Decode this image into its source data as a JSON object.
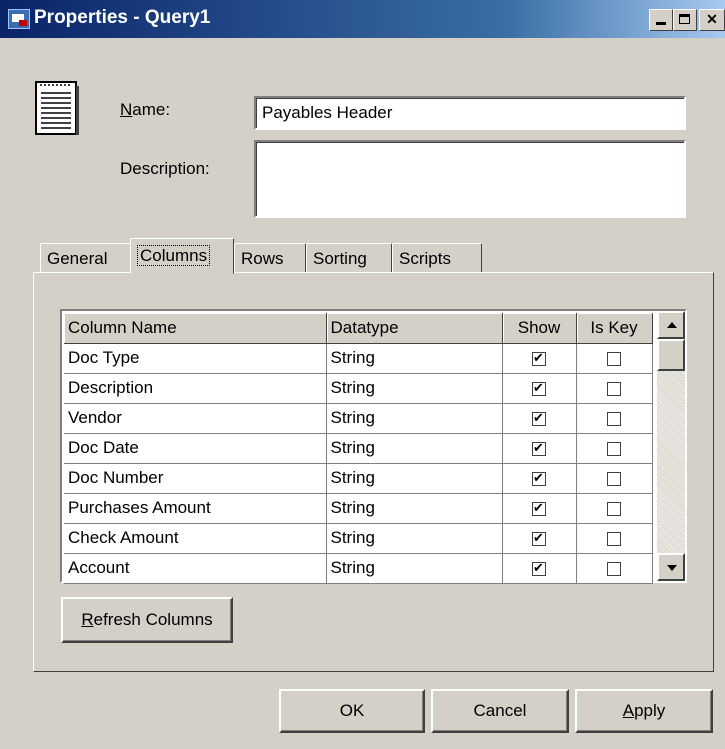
{
  "window": {
    "title": "Properties - Query1",
    "controls": [
      "minimize",
      "maximize",
      "close"
    ]
  },
  "form": {
    "name_label_rest": "ame:",
    "name_label_accel": "N",
    "name_value": "Payables Header",
    "description_label": "Description:",
    "description_value": ""
  },
  "tabs": [
    {
      "label": "General"
    },
    {
      "label": "Columns",
      "selected": true
    },
    {
      "label": "Rows"
    },
    {
      "label": "Sorting"
    },
    {
      "label": "Scripts"
    }
  ],
  "grid": {
    "headers": [
      "Column Name",
      "Datatype",
      "Show",
      "Is Key"
    ],
    "rows": [
      {
        "name": "Doc Type",
        "type": "String",
        "show": true,
        "is_key": false
      },
      {
        "name": "Description",
        "type": "String",
        "show": true,
        "is_key": false
      },
      {
        "name": "Vendor",
        "type": "String",
        "show": true,
        "is_key": false
      },
      {
        "name": "Doc Date",
        "type": "String",
        "show": true,
        "is_key": false
      },
      {
        "name": "Doc Number",
        "type": "String",
        "show": true,
        "is_key": false
      },
      {
        "name": "Purchases Amount",
        "type": "String",
        "show": true,
        "is_key": false
      },
      {
        "name": "Check Amount",
        "type": "String",
        "show": true,
        "is_key": false
      },
      {
        "name": "Account",
        "type": "String",
        "show": true,
        "is_key": false
      }
    ]
  },
  "buttons": {
    "refresh_accel": "R",
    "refresh_rest": "efresh Columns",
    "ok": "OK",
    "cancel": "Cancel",
    "apply_accel": "A",
    "apply_rest": "pply"
  }
}
